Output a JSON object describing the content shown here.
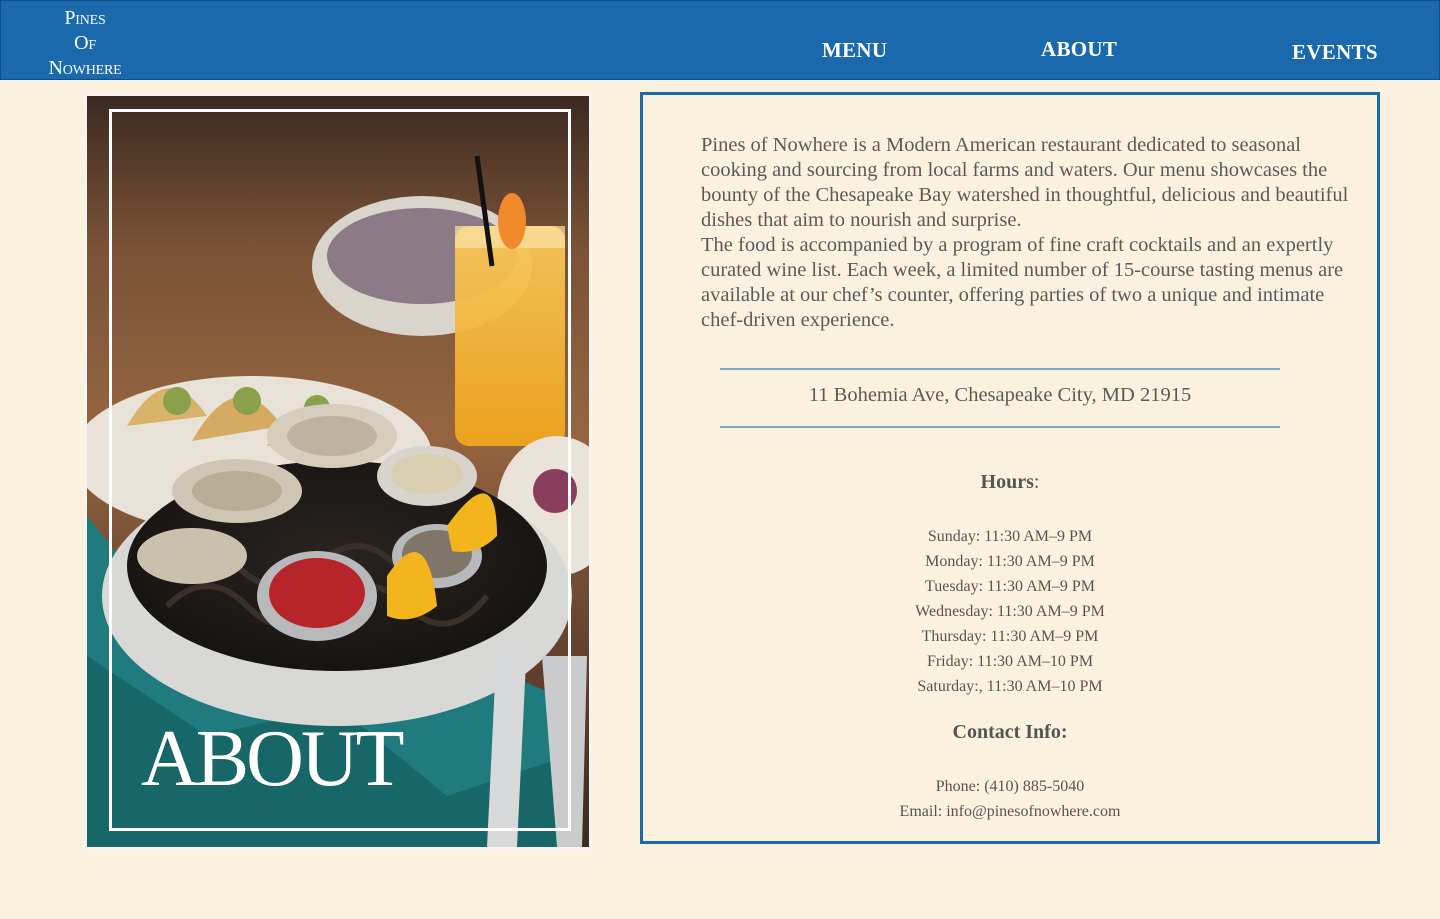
{
  "header": {
    "logo_lines": [
      "Pines",
      "Of",
      "Nowhere"
    ],
    "nav": {
      "menu": "MENU",
      "about": "ABOUT",
      "events": "EVENTS"
    }
  },
  "hero": {
    "overlay_title": "ABOUT"
  },
  "info": {
    "intro_paragraph_1": "Pines of Nowhere is a Modern American restaurant dedicated to seasonal cooking and sourcing from local farms and waters. Our menu showcases the bounty of the Chesapeake Bay watershed in thoughtful, delicious and beautiful dishes that aim to nourish and surprise.",
    "intro_paragraph_2": "The food is accompanied by a program of fine craft cocktails and an expertly curated wine list. Each week, a limited number of 15-course tasting menus are available at our chef’s counter, offering parties of two a unique and intimate chef-driven experience.",
    "address": "11 Bohemia Ave, Chesapeake City, MD 21915",
    "hours_title": "Hours",
    "hours_colon": ":",
    "hours": [
      "Sunday: 11:30 AM–9 PM",
      "Monday: 11:30 AM–9 PM",
      "Tuesday: 11:30 AM–9 PM",
      "Wednesday: 11:30 AM–9 PM",
      "Thursday:  11:30 AM–9 PM",
      "Friday: 11:30 AM–10 PM",
      "Saturday:, 11:30 AM–10 PM"
    ],
    "contact_title": "Contact Info:",
    "phone": "Phone: (410) 885-5040",
    "email": "Email: info@pinesofnowhere.com"
  },
  "colors": {
    "header_blue": "#1a69ad",
    "page_background": "#fbf1df",
    "card_border": "#1a69ad",
    "rule": "#7fa6c7",
    "body_text": "#5a5a5a"
  }
}
